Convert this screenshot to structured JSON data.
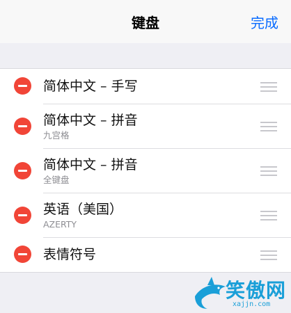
{
  "nav": {
    "title": "键盘",
    "done_label": "完成"
  },
  "keyboards": [
    {
      "name": "简体中文 – 手写",
      "subtitle": ""
    },
    {
      "name": "简体中文 – 拼音",
      "subtitle": "九宫格"
    },
    {
      "name": "简体中文 – 拼音",
      "subtitle": "全键盘"
    },
    {
      "name": "英语（美国）",
      "subtitle": "AZERTY"
    },
    {
      "name": "表情符号",
      "subtitle": ""
    }
  ],
  "watermark": {
    "text": "笑傲网",
    "url": "xajjn.com"
  },
  "colors": {
    "accent": "#0a6cff",
    "delete": "#f14537",
    "background": "#efeff4"
  }
}
